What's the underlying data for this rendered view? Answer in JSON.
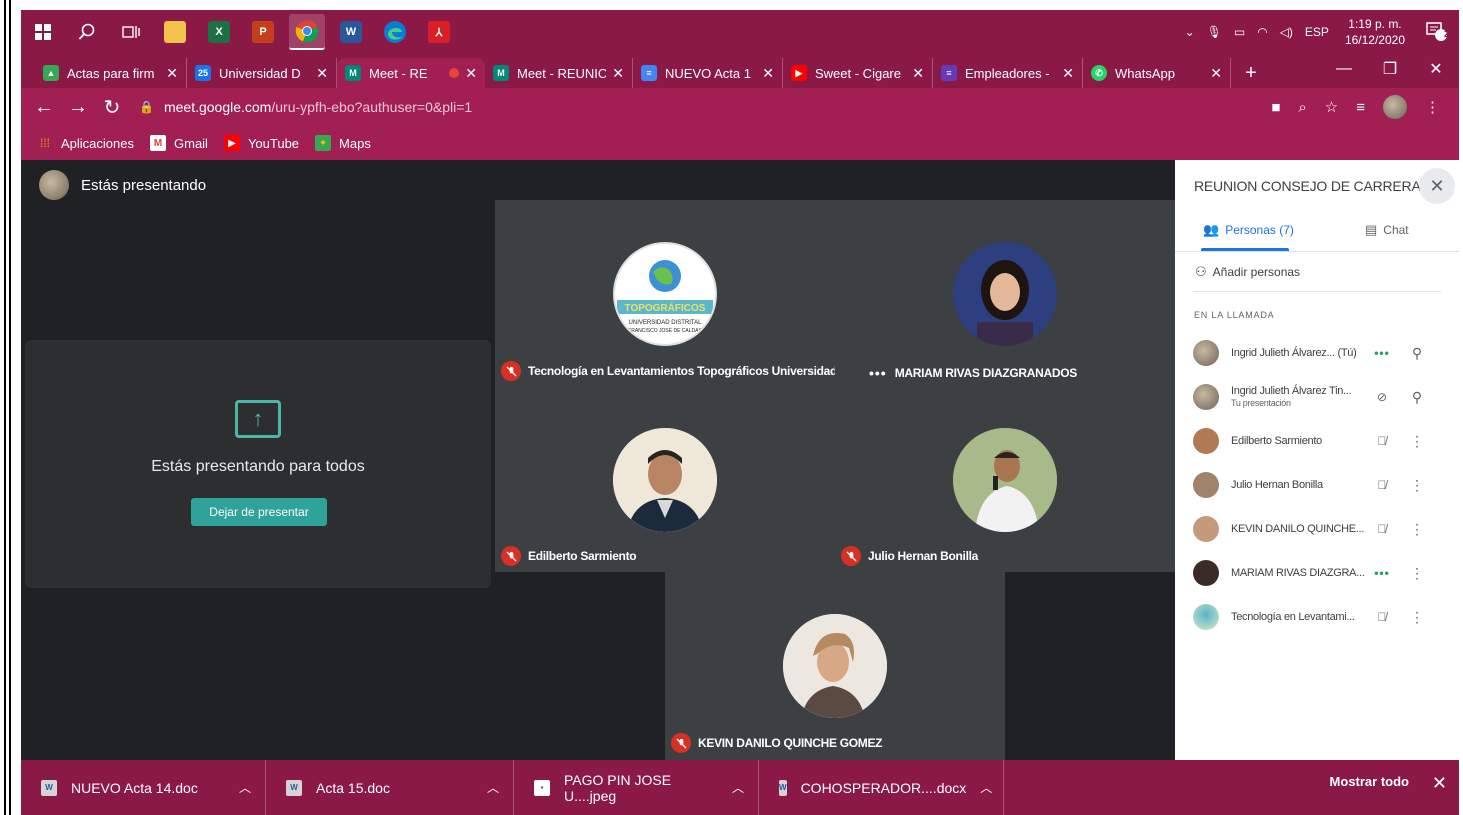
{
  "taskbar": {
    "icons": [
      "windows-start-icon",
      "search-icon",
      "task-view-icon",
      "file-explorer-icon",
      "excel-icon",
      "powerpoint-icon",
      "chrome-icon",
      "word-icon",
      "edge-icon",
      "acrobat-icon"
    ],
    "tray": {
      "language": "ESP",
      "time": "1:19 p. m.",
      "date": "16/12/2020",
      "notification_count": "2"
    }
  },
  "tabs": [
    {
      "label": "Actas para firm",
      "fav_color": "#34a853",
      "fav_text": "▲"
    },
    {
      "label": "Universidad D",
      "fav_color": "#1a73e8",
      "fav_text": "25"
    },
    {
      "label": "Meet - RE",
      "fav_color": "#00897b",
      "fav_text": "M",
      "active": true
    },
    {
      "label": "Meet - REUNIC",
      "fav_color": "#00897b",
      "fav_text": "M"
    },
    {
      "label": "NUEVO Acta 1",
      "fav_color": "#4285f4",
      "fav_text": "≡"
    },
    {
      "label": "Sweet - Cigare",
      "fav_color": "#ff0000",
      "fav_text": "▶"
    },
    {
      "label": "Empleadores -",
      "fav_color": "#673ab7",
      "fav_text": "≡"
    },
    {
      "label": "WhatsApp",
      "fav_color": "#25d366",
      "fav_text": "✆"
    }
  ],
  "address": {
    "host": "meet.google.com",
    "path": "/uru-ypfh-ebo?authuser=0&pli=1"
  },
  "bookmarks": [
    {
      "label": "Aplicaciones",
      "icon": "apps-grid-icon",
      "color": "#f4b400",
      "glyph": "⋮⋮⋮"
    },
    {
      "label": "Gmail",
      "icon": "gmail-icon",
      "color": "#ffffff",
      "glyph": "M"
    },
    {
      "label": "YouTube",
      "icon": "youtube-icon",
      "color": "#ff0000",
      "glyph": "▶"
    },
    {
      "label": "Maps",
      "icon": "maps-icon",
      "color": "#34a853",
      "glyph": "✦"
    }
  ],
  "meet": {
    "presenting_label": "Estás presentando",
    "present_message": "Estás presentando para todos",
    "stop_button": "Dejar de presentar",
    "tiles": [
      {
        "name": "Tecnología en Levantamientos Topográficos Universidad Di...",
        "muted": true,
        "avatar": "logo"
      },
      {
        "name": "MARIAM RIVAS DIAZGRANADOS",
        "muted": false,
        "avatar": "woman"
      },
      {
        "name": "Edilberto Sarmiento",
        "muted": true,
        "avatar": "man1"
      },
      {
        "name": "Julio Hernan Bonilla",
        "muted": true,
        "avatar": "man2"
      },
      {
        "name": "KEVIN DANILO QUINCHE GOMEZ",
        "muted": true,
        "avatar": "man3"
      }
    ],
    "logo_text": {
      "band": "TOPOGRÁFICOS",
      "line1": "UNIVERSIDAD DISTRITAL",
      "line2": "FRANCISCO JOSÉ DE CALDAS"
    }
  },
  "panel": {
    "title": "REUNION CONSEJO DE CARRERA",
    "tab_people": "Personas (7)",
    "tab_chat": "Chat",
    "add_people": "Añadir personas",
    "section": "EN LA LLAMADA",
    "people": [
      {
        "name": "Ingrid Julieth Álvarez... (Tú)",
        "sub": "",
        "status": "talk",
        "menu": "pin",
        "avatar_color": "#8d7b65"
      },
      {
        "name": "Ingrid Julieth Álvarez Tin...",
        "sub": "Tu presentación",
        "status": "present-off",
        "menu": "pin",
        "avatar_color": "#8d7b65"
      },
      {
        "name": "Edilberto Sarmiento",
        "sub": "",
        "status": "muted",
        "menu": "more",
        "avatar_color": "#b07a52"
      },
      {
        "name": "Julio Hernan Bonilla",
        "sub": "",
        "status": "muted",
        "menu": "more",
        "avatar_color": "#a0826d"
      },
      {
        "name": "KEVIN DANILO QUINCHE...",
        "sub": "",
        "status": "muted",
        "menu": "more",
        "avatar_color": "#c49a7a"
      },
      {
        "name": "MARIAM RIVAS DIAZGRA...",
        "sub": "",
        "status": "talk",
        "menu": "more",
        "avatar_color": "#3a2b26"
      },
      {
        "name": "Tecnología en Levantami...",
        "sub": "",
        "status": "muted",
        "menu": "more",
        "avatar_color": "#58b4c9"
      }
    ]
  },
  "downloads": {
    "items": [
      {
        "label": "NUEVO Acta 14.doc"
      },
      {
        "label": "Acta 15.doc"
      },
      {
        "label": "PAGO PIN JOSE U....jpeg"
      },
      {
        "label": "COHOSPERADOR....docx"
      }
    ],
    "show_all": "Mostrar todo"
  }
}
